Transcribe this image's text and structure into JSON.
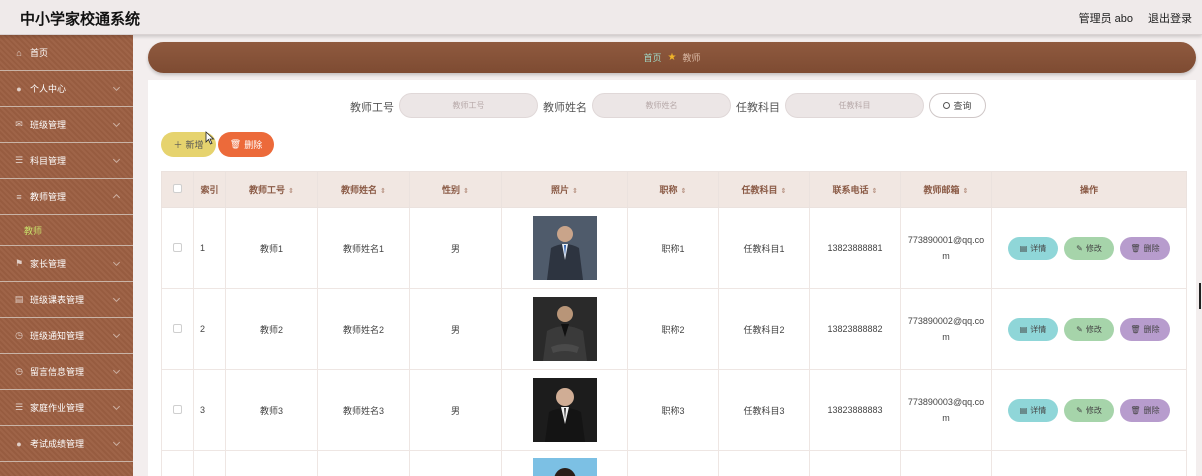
{
  "header": {
    "app_title": "中小学家校通系统",
    "user": "管理员 abo",
    "logout": "退出登录"
  },
  "sidebar": {
    "items": [
      {
        "label": "首页",
        "icon": "home-icon"
      },
      {
        "label": "个人中心",
        "icon": "user-icon"
      },
      {
        "label": "班级管理",
        "icon": "mail-icon"
      },
      {
        "label": "科目管理",
        "icon": "list-icon"
      },
      {
        "label": "教师管理",
        "icon": "menu-icon"
      },
      {
        "label": "家长管理",
        "icon": "flag-icon"
      },
      {
        "label": "班级课表管理",
        "icon": "calendar-icon"
      },
      {
        "label": "班级通知管理",
        "icon": "clock-icon"
      },
      {
        "label": "留言信息管理",
        "icon": "clock-icon"
      },
      {
        "label": "家庭作业管理",
        "icon": "list-icon"
      },
      {
        "label": "考试成绩管理",
        "icon": "user-icon"
      }
    ],
    "sub_item": "教师"
  },
  "breadcrumb": {
    "home": "首页",
    "current": "教师"
  },
  "search": {
    "fields": [
      {
        "label": "教师工号",
        "placeholder": "教师工号"
      },
      {
        "label": "教师姓名",
        "placeholder": "教师姓名"
      },
      {
        "label": "任教科目",
        "placeholder": "任教科目"
      }
    ],
    "button": "查询"
  },
  "actions": {
    "add": "新增",
    "delete": "删除"
  },
  "table": {
    "headers": [
      "索引",
      "教师工号",
      "教师姓名",
      "性别",
      "照片",
      "职称",
      "任教科目",
      "联系电话",
      "教师邮箱",
      "操作"
    ],
    "rows": [
      {
        "index": "1",
        "id": "教师1",
        "name": "教师姓名1",
        "gender": "男",
        "title": "职称1",
        "subject": "任教科目1",
        "phone": "13823888881",
        "email": "773890001@qq.com"
      },
      {
        "index": "2",
        "id": "教师2",
        "name": "教师姓名2",
        "gender": "男",
        "title": "职称2",
        "subject": "任教科目2",
        "phone": "13823888882",
        "email": "773890002@qq.com"
      },
      {
        "index": "3",
        "id": "教师3",
        "name": "教师姓名3",
        "gender": "男",
        "title": "职称3",
        "subject": "任教科目3",
        "phone": "13823888883",
        "email": "773890003@qq.com"
      }
    ],
    "row_actions": {
      "detail": "详情",
      "edit": "修改",
      "delete": "删除"
    }
  },
  "colors": {
    "sidebar": "#9c5f42",
    "accent_green": "#c8e06a",
    "add_button": "#e6d36e",
    "delete_button": "#ec6a3a"
  }
}
